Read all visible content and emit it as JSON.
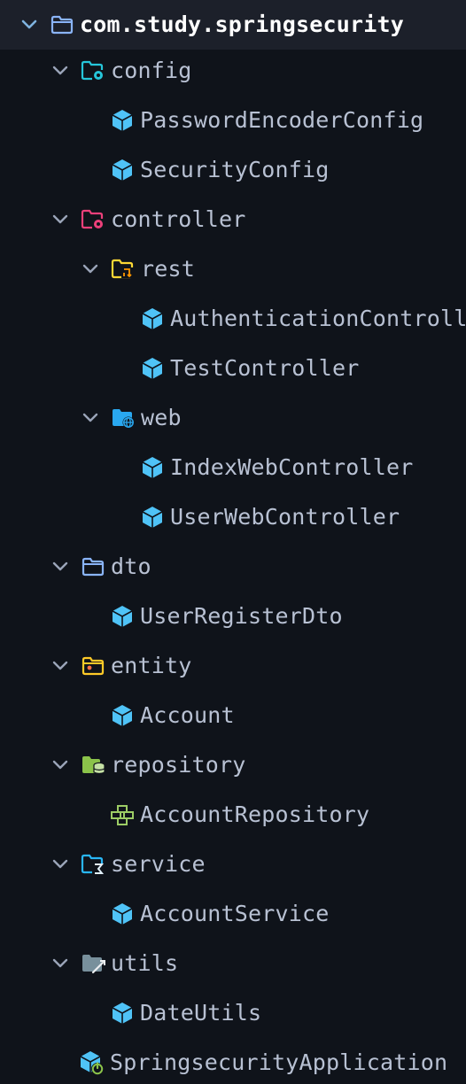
{
  "tree": {
    "root": {
      "label": "com.study.springsecurity",
      "icon": "folder-icon"
    },
    "config": {
      "label": "config",
      "icon": "config-folder-icon"
    },
    "password_encoder_config": {
      "label": "PasswordEncoderConfig",
      "icon": "class-icon"
    },
    "security_config": {
      "label": "SecurityConfig",
      "icon": "class-icon"
    },
    "controller": {
      "label": "controller",
      "icon": "controller-folder-icon"
    },
    "rest": {
      "label": "rest",
      "icon": "rest-folder-icon"
    },
    "authentication_controller": {
      "label": "AuthenticationControll",
      "icon": "class-icon"
    },
    "test_controller": {
      "label": "TestController",
      "icon": "class-icon"
    },
    "web": {
      "label": "web",
      "icon": "web-folder-icon"
    },
    "index_web_controller": {
      "label": "IndexWebController",
      "icon": "class-icon"
    },
    "user_web_controller": {
      "label": "UserWebController",
      "icon": "class-icon"
    },
    "dto": {
      "label": "dto",
      "icon": "folder-icon"
    },
    "user_register_dto": {
      "label": "UserRegisterDto",
      "icon": "class-icon"
    },
    "entity": {
      "label": "entity",
      "icon": "entity-folder-icon"
    },
    "account": {
      "label": "Account",
      "icon": "class-icon"
    },
    "repository": {
      "label": "repository",
      "icon": "repository-folder-icon"
    },
    "account_repository": {
      "label": "AccountRepository",
      "icon": "repository-interface-icon"
    },
    "service": {
      "label": "service",
      "icon": "service-folder-icon"
    },
    "account_service": {
      "label": "AccountService",
      "icon": "class-icon"
    },
    "utils": {
      "label": "utils",
      "icon": "utils-folder-icon"
    },
    "date_utils": {
      "label": "DateUtils",
      "icon": "class-icon"
    },
    "springsecurity_application": {
      "label": "SpringsecurityApplication",
      "icon": "spring-boot-app-icon"
    }
  },
  "colors": {
    "background": "#0f131a",
    "selected_row": "#1c202a",
    "class_icon": "#4fc3f7",
    "text": "#b8c1d3",
    "root_text": "#ffffff",
    "chevron": "#9aa4b8"
  }
}
